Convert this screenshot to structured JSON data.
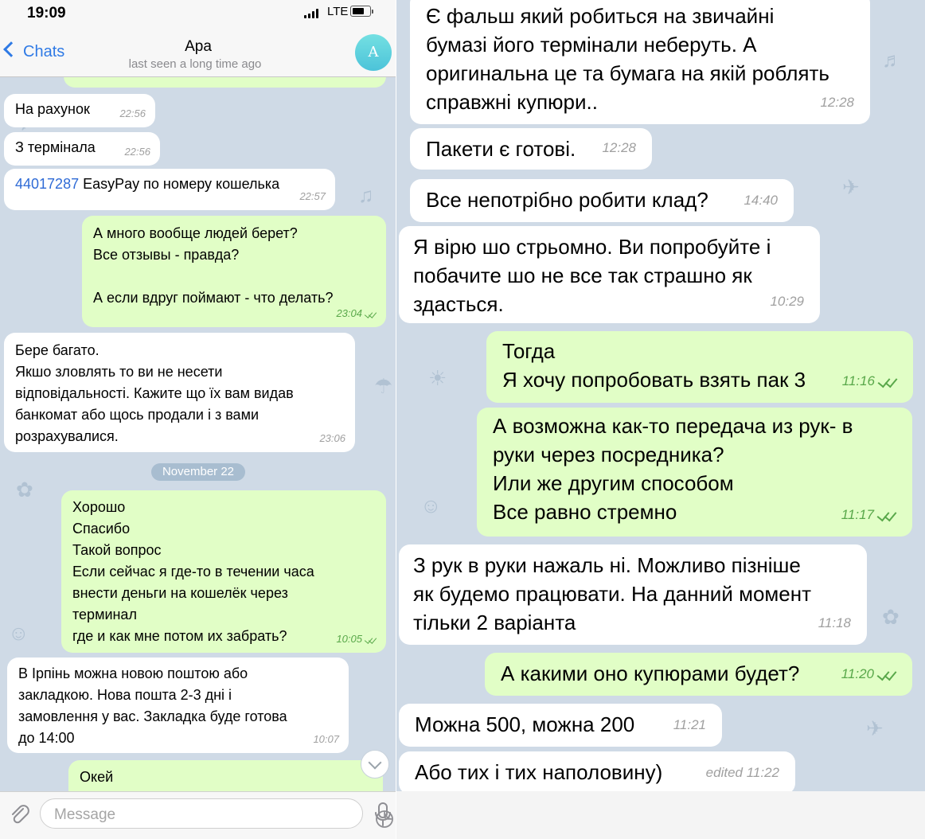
{
  "status": {
    "time": "19:09",
    "network": "LTE"
  },
  "header": {
    "back_label": "Chats",
    "title": "Apa",
    "subtitle": "last seen a long time ago",
    "avatar_letter": "A"
  },
  "left_messages": [
    {
      "text": "На рахунок",
      "time": "22:56"
    },
    {
      "text": "З термінала",
      "time": "22:56"
    },
    {
      "link": "44017287",
      "text": " EasyPay по номеру кошелька",
      "time": "22:57"
    },
    {
      "text": "А много вообще людей берет?\nВсе отзывы - правда?\n\nА если вдруг поймают - что делать?",
      "time": "23:04"
    },
    {
      "text": "Бере багато.\nЯкшо зловлять то ви не несети\nвідповідальності. Кажите що їх вам видав\nбанкомат або щось продали і з вами\nрозрахувалися.",
      "time": "23:06"
    },
    {
      "text": "Хорошо\nСпасибо\nТакой вопрос\nЕсли сейчас я где-то в течении часа\nвнести деньги на кошелёк через\nтерминал\nгде и как мне потом их забрать?",
      "time": "10:05"
    },
    {
      "text": "В Ірпінь можна новою поштою або\nзакладкою. Нова пошта 2-3 дні і\nзамовлення у вас. Закладка буде готова\nдо 14:00",
      "time": "10:07"
    },
    {
      "text": "Окей"
    }
  ],
  "date_separator": "November 22",
  "input": {
    "placeholder": "Message"
  },
  "right_messages": [
    {
      "text": "Є фальш який робиться на звичайні\nбумазі його термінали неберуть. А\nоригинальна це та бумага на якій роблять\nсправжні купюри..",
      "time": "12:28"
    },
    {
      "text": "Пакети є готові.",
      "time": "12:28"
    },
    {
      "text": "Все непотрібно робити клад?",
      "time": "14:40"
    },
    {
      "text": "Я вірю шо стрьомно. Ви попробуйте і\nпобачите шо не все так страшно як\nздасться.",
      "time": "10:29"
    },
    {
      "text": "Тогда\nЯ хочу попробовать взять пак 3",
      "time": "11:16"
    },
    {
      "text": "А возможна как-то передача из рук- в\nруки через посредника?\nИли же другим способом\nВсе равно стремно",
      "time": "11:17"
    },
    {
      "text": "З рук в руки нажаль ні. Можливо пізніше\nяк будемо працювати. На данний момент\nтільки 2 варіанта",
      "time": "11:18"
    },
    {
      "text": "А какими оно купюрами будет?",
      "time": "11:20"
    },
    {
      "text": "Можна 500, можна 200",
      "time": "11:21"
    },
    {
      "text": "Або тих і тих наполовину)",
      "time": "edited 11:22"
    }
  ]
}
